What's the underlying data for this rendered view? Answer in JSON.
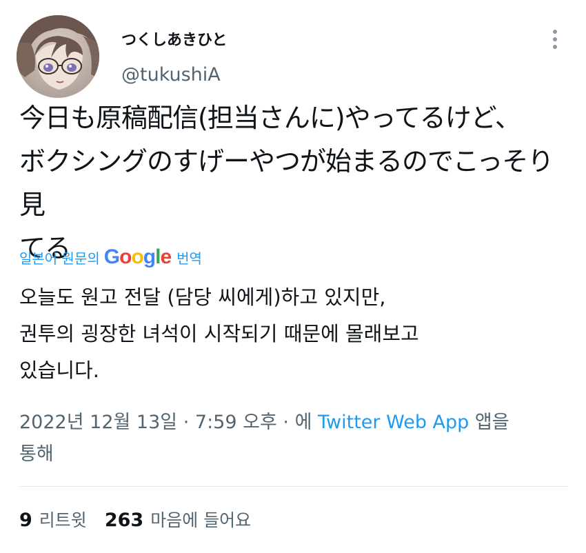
{
  "tweet": {
    "author": {
      "display_name": "つくしあきひと",
      "handle": "@tukushiA"
    },
    "text_lines": [
      "今日も原稿配信(担当さんに)やってるけど、",
      "ボクシングのすげーやつが始まるのでこっそり見",
      "てる"
    ],
    "translation": {
      "label": "일본어 원문의",
      "provider": {
        "letters": [
          "G",
          "o",
          "o",
          "g",
          "l",
          "e"
        ],
        "colors": [
          "#4285f4",
          "#ea4335",
          "#fbbc05",
          "#4285f4",
          "#34a853",
          "#ea4335"
        ]
      },
      "suffix": "번역",
      "lines": [
        "오늘도 원고 전달 (담당 씨에게)하고 있지만,",
        "권투의 굉장한 녀석이 시작되기 때문에 몰래보고",
        "있습니다."
      ]
    },
    "meta": {
      "date": "2022년 12월 13일",
      "separator": "·",
      "time": "7:59 오후",
      "via_prefix": "에",
      "source": "Twitter Web App",
      "via_suffix_1": "앱을",
      "via_suffix_2": "통해"
    },
    "stats": {
      "retweets": "9",
      "retweets_label": "리트윗",
      "likes": "263",
      "likes_label": "마음에 들어요"
    }
  },
  "colors": {
    "accent": "#1d9bf0",
    "secondary_text": "#536471",
    "primary_text": "#0f1419",
    "divider": "#e4e8eb"
  },
  "icons": {
    "more": "vertical-ellipsis-icon",
    "avatar": "user-avatar-illustration"
  }
}
